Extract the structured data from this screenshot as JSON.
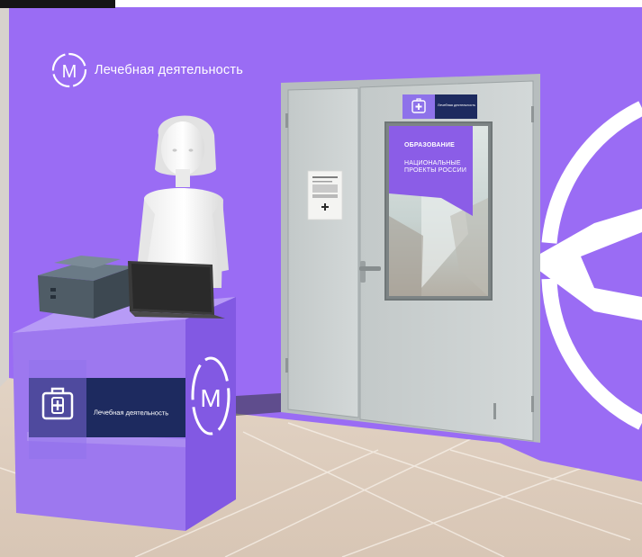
{
  "brand": {
    "logo_letter": "М",
    "logo_text": "Лечебная деятельность"
  },
  "reception_desk": {
    "panel_text": "Лечебная деятельность",
    "panel_icon": "medical-kit-icon",
    "side_logo_letter": "М"
  },
  "door": {
    "sign_text": "Лечебная деятельность",
    "sign_icon": "medical-kit-icon",
    "window_title": "ОБРАЗОВАНИЕ",
    "window_subtitle": "НАЦИОНАЛЬНЫЕ ПРОЕКТЫ РОССИИ"
  },
  "colors": {
    "wall_purple": "#9a6cf4",
    "desk_purple": "#9d78ef",
    "navy_panel": "#1d2a5f",
    "door_grey": "#c7cdcd",
    "floor": "#e7dacd"
  }
}
